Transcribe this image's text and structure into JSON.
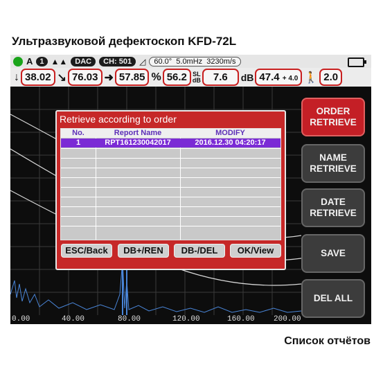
{
  "page_title": "Ультразвуковой дефектоскоп KFD-72L",
  "caption": "Список отчётов",
  "status_bar": {
    "mode": "A",
    "channel_num": "1",
    "dac": "DAC",
    "channel": "CH: 501",
    "angle": "60.0°",
    "frequency": "5.0mHz",
    "velocity": "3230m/s"
  },
  "readings": {
    "depth": "38.02",
    "surface_distance": "76.03",
    "sound_path": "57.85",
    "percent_symbol": "%",
    "amplitude_percent": "56.2",
    "sl_label_top": "SL",
    "sl_label_bottom": "dB",
    "sl_value": "7.6",
    "db_label": "dB",
    "gain": "47.4",
    "gain_offset": "+ 4.0",
    "probe_value": "2.0"
  },
  "x_axis_labels": [
    "0.00",
    "40.00",
    "80.00",
    "120.00",
    "160.00",
    "200.00"
  ],
  "side_buttons": [
    {
      "label": "ORDER\nRETRIEVE",
      "active": true
    },
    {
      "label": "NAME\nRETRIEVE",
      "active": false
    },
    {
      "label": "DATE\nRETRIEVE",
      "active": false
    },
    {
      "label": "SAVE",
      "active": false
    },
    {
      "label": "DEL ALL",
      "active": false
    }
  ],
  "dialog": {
    "title": "Retrieve according to order",
    "columns": [
      "No.",
      "Report Name",
      "MODIFY"
    ],
    "rows": [
      {
        "no": "1",
        "name": "RPT161230042017",
        "modify": "2016.12.30  04:20:17"
      }
    ],
    "buttons": [
      "ESC/Back",
      "DB+/REN",
      "DB-/DEL",
      "OK/View"
    ]
  },
  "colors": {
    "accent_red": "#c62828",
    "selection_purple": "#7b2bd5",
    "status_green": "#1aa41a"
  }
}
